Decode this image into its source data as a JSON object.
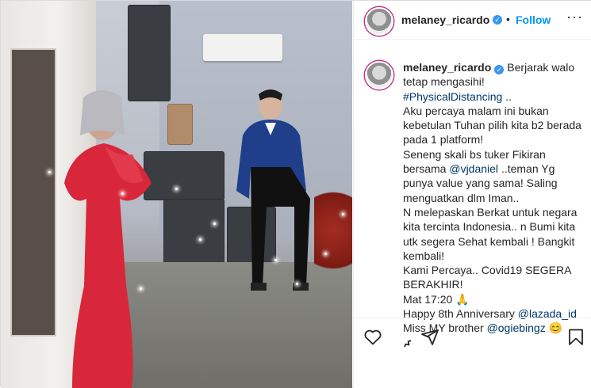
{
  "header": {
    "username": "melaney_ricardo",
    "separator": "•",
    "follow_label": "Follow",
    "more_label": "···"
  },
  "caption": {
    "username": "melaney_ricardo",
    "lines": [
      "Berjarak walo tetap mengasihi!",
      "#PhysicalDistancing ..",
      "Aku percaya malam ini bukan kebetulan Tuhan pilih kita b2 berada pada 1 platform!",
      "Seneng skali bs tuker Fikiran bersama",
      "@vjdaniel",
      "..teman Yg punya value yang sama! Saling menguatkan dlm Iman..",
      "N melepaskan Berkat untuk negara kita tercinta Indonesia.. n Bumi kita utk segera Sehat kembali ! Bangkit kembali!",
      "Kami Percaya.. Covid19 SEGERA BERAKHIR!",
      "Mat 17:20",
      "🙏",
      "Happy 8th Anniversary",
      "@lazada_id",
      "Miss MY brother",
      "@ogiebingz",
      "😊"
    ]
  },
  "colors": {
    "accent": "#0095f6",
    "verified": "#3897f0",
    "mention": "#00376b",
    "text": "#262626",
    "dress": "#d8263a",
    "suit": "#1f3f8a"
  },
  "icons": {
    "like": "heart-icon",
    "comment": "comment-icon",
    "share": "share-icon",
    "save": "bookmark-icon",
    "verified": "verified-badge-icon"
  }
}
